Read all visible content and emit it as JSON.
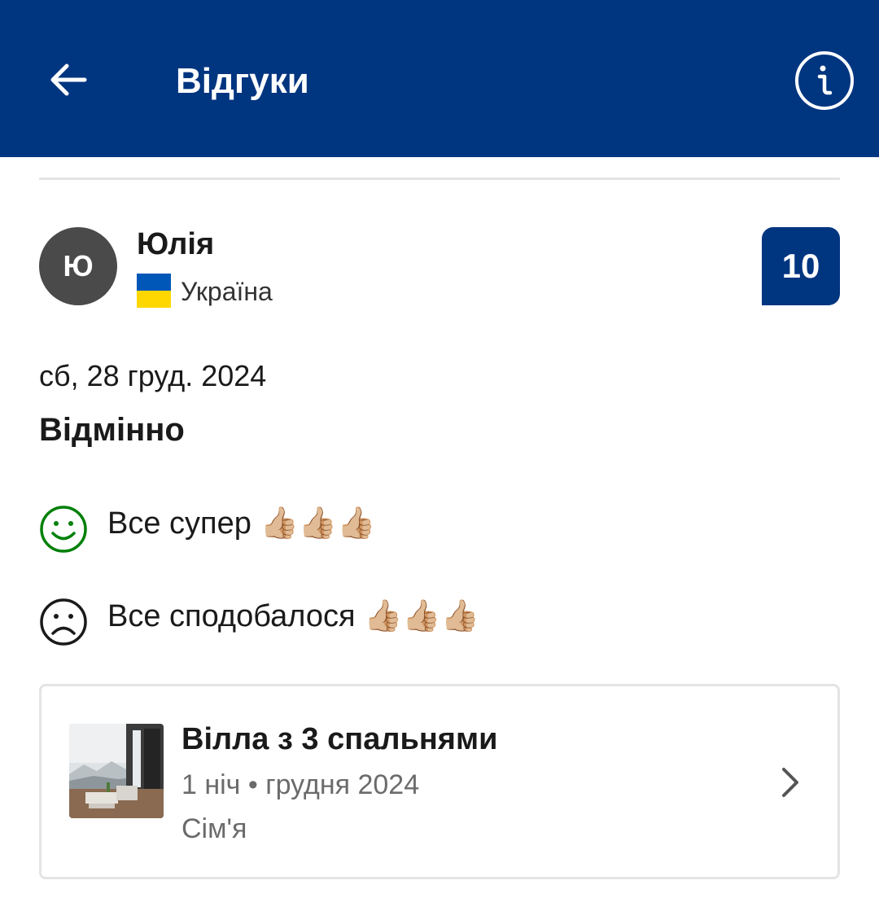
{
  "appbar": {
    "title": "Відгуки",
    "back_icon": "arrow-left-icon",
    "info_icon": "info-circle-icon",
    "bg_color": "#003580"
  },
  "review": {
    "avatar_initial": "Ю",
    "reviewer_name": "Юлія",
    "country": "Україна",
    "flag_colors": [
      "#0057B7",
      "#FFD700"
    ],
    "score": "10",
    "date": "сб, 28 груд. 2024",
    "headline": "Відмінно",
    "pros": "Все супер 👍🏼👍🏼👍🏼",
    "cons": "Все сподобалося 👍🏼👍🏼👍🏼",
    "pros_icon": "smiley-happy-icon",
    "cons_icon": "smiley-sad-icon"
  },
  "room_card": {
    "name": "Вілла з 3 спальнями",
    "meta": "1 ніч • грудня 2024",
    "traveler_type": "Сім'я",
    "thumbnail_icon": "room-photo",
    "chevron_icon": "chevron-right-icon"
  }
}
